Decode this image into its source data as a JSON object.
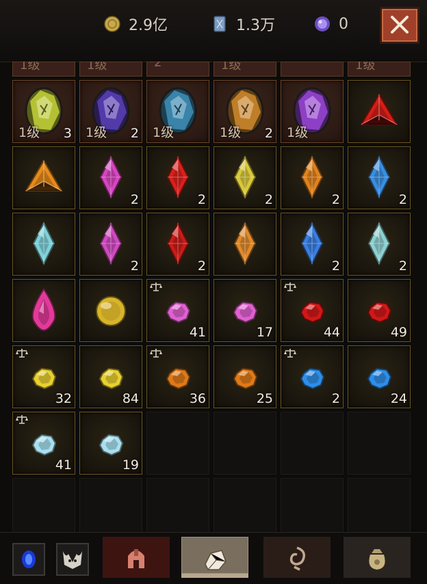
{
  "currencies": [
    {
      "icon": "gold-coin-icon",
      "value": "2.9亿",
      "color": "#c9a84a"
    },
    {
      "icon": "scroll-card-icon",
      "value": "1.3万",
      "color": "#7d9bc0"
    },
    {
      "icon": "purple-orb-icon",
      "value": "0",
      "color": "#8a6ad0"
    }
  ],
  "cut_row": [
    "1级",
    "1级",
    "2",
    "1级",
    "",
    "1级",
    "1级"
  ],
  "items": [
    {
      "type": "rune",
      "icon": "yellow-rune-stone-icon",
      "color": "#c6d23a",
      "level": "1级",
      "count": "3"
    },
    {
      "type": "rune",
      "icon": "purple-rune-stone-icon",
      "color": "#5a3fb8",
      "level": "1级",
      "count": "2"
    },
    {
      "type": "rune",
      "icon": "blue-rune-stone-icon",
      "color": "#3f8fb8",
      "level": "1级",
      "count": ""
    },
    {
      "type": "rune",
      "icon": "amber-rune-crystal-icon",
      "color": "#d08a2c",
      "level": "1级",
      "count": "2"
    },
    {
      "type": "rune",
      "icon": "violet-rune-crystal-icon",
      "color": "#9a47d8",
      "level": "1级",
      "count": ""
    },
    {
      "type": "triangle",
      "icon": "red-triangle-gem-icon",
      "color": "#d21e16",
      "level": "",
      "count": ""
    },
    {
      "type": "triangle",
      "icon": "orange-triangle-gem-icon",
      "color": "#e68a1a",
      "level": "",
      "count": ""
    },
    {
      "type": "marquise",
      "icon": "pink-marquise-gem-icon",
      "color": "#d845c0",
      "level": "",
      "count": "2"
    },
    {
      "type": "marquise",
      "icon": "red-marquise-gem-icon",
      "color": "#d8201c",
      "level": "",
      "count": "2"
    },
    {
      "type": "marquise",
      "icon": "yellow-marquise-gem-icon",
      "color": "#d8c83a",
      "level": "",
      "count": "2"
    },
    {
      "type": "marquise",
      "icon": "orange-marquise-gem-icon",
      "color": "#e0821c",
      "level": "",
      "count": "2"
    },
    {
      "type": "marquise",
      "icon": "blue-marquise-gem-icon",
      "color": "#3a8ee0",
      "level": "",
      "count": "2"
    },
    {
      "type": "marquise",
      "icon": "teal-marquise-gem-icon",
      "color": "#7fd0d8",
      "level": "",
      "count": ""
    },
    {
      "type": "marquise",
      "icon": "pink-marquise-gem-icon",
      "color": "#d04ac0",
      "level": "",
      "count": "2"
    },
    {
      "type": "marquise",
      "icon": "red-marquise-gem-icon",
      "color": "#c81c18",
      "level": "",
      "count": "2"
    },
    {
      "type": "marquise",
      "icon": "orange-marquise-gem-icon",
      "color": "#e08a2a",
      "level": "",
      "count": ""
    },
    {
      "type": "marquise",
      "icon": "blue-marquise-gem-icon",
      "color": "#3a7ee0",
      "level": "",
      "count": "2"
    },
    {
      "type": "marquise",
      "icon": "teal-marquise-gem-icon",
      "color": "#8ed0d0",
      "level": "",
      "count": "2"
    },
    {
      "type": "teardrop",
      "icon": "pink-teardrop-gem-icon",
      "color": "#e23a9a",
      "level": "",
      "count": ""
    },
    {
      "type": "orb",
      "icon": "gold-orb-icon",
      "color": "#d8b42a",
      "level": "",
      "count": ""
    },
    {
      "type": "stone",
      "icon": "pink-stone-icon",
      "color": "#e060d0",
      "level": "",
      "count": "41",
      "scale": true
    },
    {
      "type": "stone",
      "icon": "pink-stone-icon",
      "color": "#e060d0",
      "level": "",
      "count": "17"
    },
    {
      "type": "stone",
      "icon": "red-stone-icon",
      "color": "#d01818",
      "level": "",
      "count": "44",
      "scale": true
    },
    {
      "type": "stone",
      "icon": "red-stone-icon",
      "color": "#d01818",
      "level": "",
      "count": "49"
    },
    {
      "type": "stone",
      "icon": "yellow-stone-icon",
      "color": "#e8d030",
      "level": "",
      "count": "32",
      "scale": true
    },
    {
      "type": "stone",
      "icon": "yellow-stone-icon",
      "color": "#e8d030",
      "level": "",
      "count": "84"
    },
    {
      "type": "stone",
      "icon": "orange-stone-icon",
      "color": "#e07a18",
      "level": "",
      "count": "36",
      "scale": true
    },
    {
      "type": "stone",
      "icon": "orange-stone-icon",
      "color": "#e07a18",
      "level": "",
      "count": "25"
    },
    {
      "type": "stone",
      "icon": "blue-stone-icon",
      "color": "#2e8ee8",
      "level": "",
      "count": "2",
      "scale": true
    },
    {
      "type": "stone",
      "icon": "blue-stone-icon",
      "color": "#2e8ee8",
      "level": "",
      "count": "24"
    },
    {
      "type": "stone",
      "icon": "white-stone-icon",
      "color": "#a8e0f0",
      "level": "",
      "count": "41",
      "scale": true
    },
    {
      "type": "stone",
      "icon": "white-stone-icon",
      "color": "#a8e0f0",
      "level": "",
      "count": "19"
    }
  ],
  "bottom_bar": [
    {
      "icon": "blue-portal-icon",
      "kind": "square"
    },
    {
      "icon": "demon-skull-icon",
      "kind": "square"
    },
    {
      "icon": "helmet-tab-icon",
      "kind": "tab",
      "active": false,
      "bg": "#3e1411"
    },
    {
      "icon": "gems-tab-icon",
      "kind": "tab",
      "active": true,
      "bg": "#7a6e5e"
    },
    {
      "icon": "rune-swirl-tab-icon",
      "kind": "tab",
      "active": false,
      "bg": "#2a1d18"
    },
    {
      "icon": "gold-bag-tab-icon",
      "kind": "tab",
      "active": false,
      "bg": "#2a2420"
    }
  ]
}
